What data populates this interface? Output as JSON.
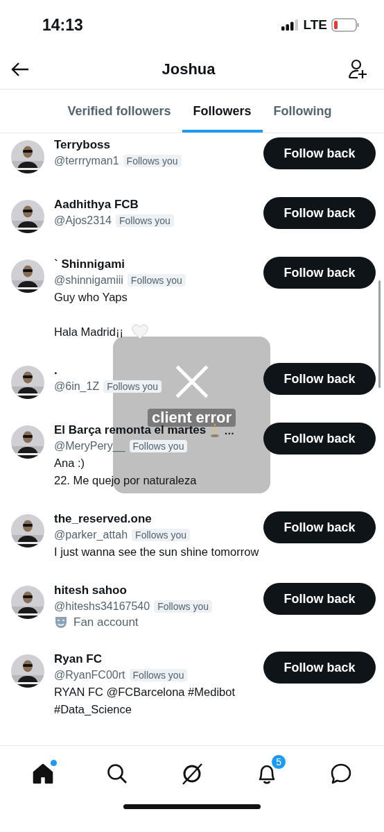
{
  "status_bar": {
    "time": "14:13",
    "network": "LTE"
  },
  "header": {
    "title": "Joshua"
  },
  "tabs": [
    {
      "label": "Verified followers",
      "selected": false
    },
    {
      "label": "Followers",
      "selected": true
    },
    {
      "label": "Following",
      "selected": false
    }
  ],
  "followers": [
    {
      "kind": "plain",
      "name": "Terryboss",
      "handle": "@terrryman1",
      "badge": "Follows you",
      "button": "Follow back"
    },
    {
      "kind": "plain",
      "name": "Aadhithya FCB",
      "handle": "@Ajos2314",
      "badge": "Follows you",
      "button": "Follow back"
    },
    {
      "kind": "heart_bio",
      "name": "` Shinnigami",
      "handle": "@shinnigamiii",
      "badge": "Follows you",
      "button": "Follow back",
      "bio": "Guy who Yaps\n\nHala Madrid¡¡"
    },
    {
      "kind": "plain",
      "name": ".",
      "handle": "@6in_1Z",
      "badge": "Follows you",
      "button": "Follow back"
    },
    {
      "kind": "candle_name",
      "name": "El Barça remonta el martes",
      "name_more": "…",
      "handle": "@MeryPery__",
      "badge": "Follows you",
      "button": "Follow back",
      "bio": "Ana :)\n22. Me quejo por naturaleza"
    },
    {
      "kind": "plain",
      "name": "the_reserved.one",
      "handle": "@parker_attah",
      "badge": "Follows you",
      "button": "Follow back",
      "bio": "I just wanna see the sun shine tomorrow"
    },
    {
      "kind": "fan_account",
      "name": "hitesh sahoo",
      "handle": "@hiteshs34167540",
      "badge": "Follows you",
      "button": "Follow back",
      "label": "Fan account"
    },
    {
      "kind": "plain",
      "name": "Ryan FC",
      "handle": "@RyanFC00rt",
      "badge": "Follows you",
      "button": "Follow back",
      "bio": "RYAN FC @FCBarcelona #Medibot #Data_Science"
    }
  ],
  "toast": {
    "message": "client error"
  },
  "bottom_nav": [
    {
      "kind": "home",
      "selected": true,
      "dot": true
    },
    {
      "kind": "search",
      "selected": false
    },
    {
      "kind": "grok",
      "selected": false
    },
    {
      "kind": "bell",
      "selected": false,
      "badge": "5"
    },
    {
      "kind": "chat",
      "selected": false
    }
  ]
}
